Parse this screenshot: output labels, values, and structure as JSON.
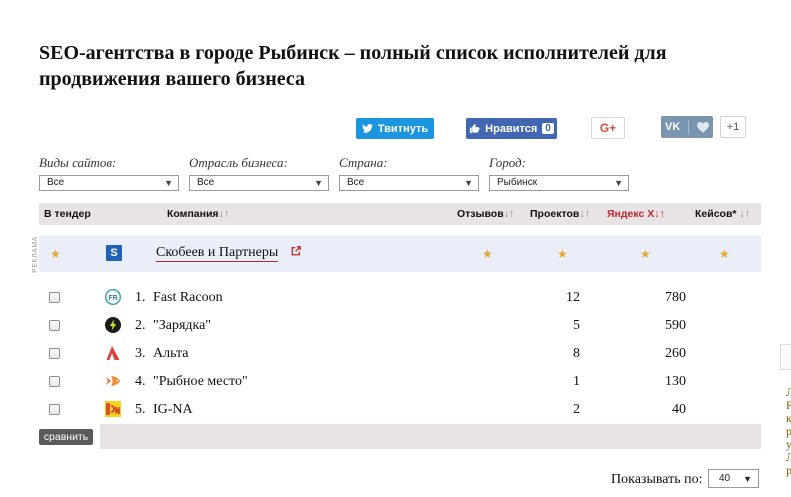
{
  "page": {
    "title": "SEO-агентства в городе Рыбинск – полный список исполнителей для продвижения вашего бизнеса"
  },
  "social": {
    "twitter_label": "Твитнуть",
    "facebook_label": "Нравится",
    "facebook_count": "0",
    "gplus_label": "G+",
    "vk_label": "VK",
    "vk_count": "+1"
  },
  "filters": [
    {
      "label": "Виды сайтов:",
      "value": "Все"
    },
    {
      "label": "Отрасль бизнеса:",
      "value": "Все"
    },
    {
      "label": "Страна:",
      "value": "Все"
    },
    {
      "label": "Город:",
      "value": "Рыбинск"
    }
  ],
  "table": {
    "headers": {
      "tender": "В тендер",
      "company": "Компания",
      "reviews": "Отзывов",
      "projects": "Проектов",
      "yandex": "Яндекс Х",
      "cases": "Кейсов*",
      "sort_arrows": "↓↑"
    },
    "ad": {
      "label": "РЕКЛАМА",
      "logo_letter": "S",
      "name": "Скобеев и Партнеры",
      "star": "★"
    },
    "rows": [
      {
        "num": "1.",
        "name": "Fast Racoon",
        "projects": "12",
        "yandex": "780"
      },
      {
        "num": "2.",
        "name": "\"Зарядка\"",
        "projects": "5",
        "yandex": "590"
      },
      {
        "num": "3.",
        "name": "Альта",
        "projects": "8",
        "yandex": "260"
      },
      {
        "num": "4.",
        "name": "\"Рыбное место\"",
        "projects": "1",
        "yandex": "130"
      },
      {
        "num": "5.",
        "name": "IG-NA",
        "projects": "2",
        "yandex": "40"
      }
    ]
  },
  "compare_button": "сравнить",
  "pagination": {
    "label": "Показывать по:",
    "value": "40"
  },
  "colors": {
    "accent_red": "#c0272d",
    "star": "#e7a934",
    "header_bg": "#e8e3e4",
    "ad_bg": "#e9eef8"
  }
}
